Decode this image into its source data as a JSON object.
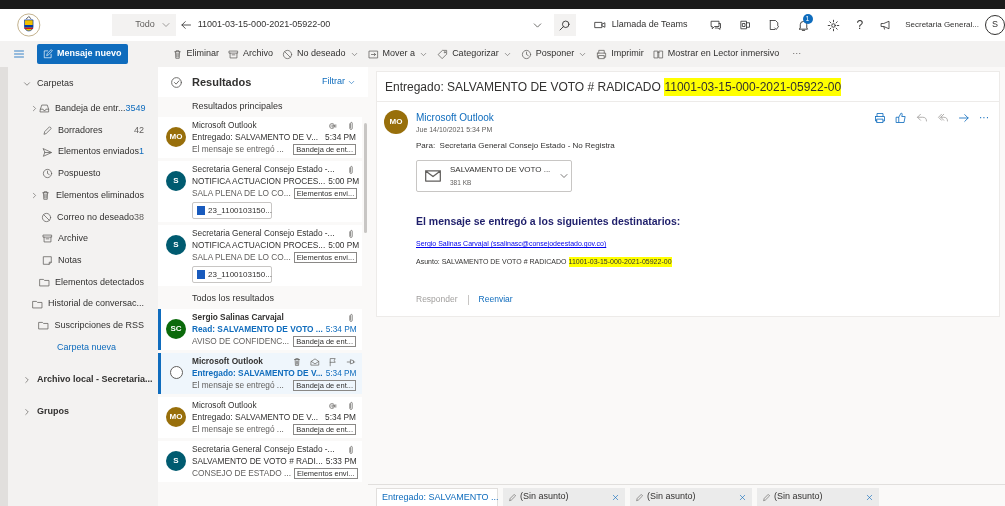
{
  "header": {
    "search_scope": "Todo",
    "search_value": "11001-03-15-000-2021-05922-00",
    "teams": "Llamada de Teams",
    "notification_badge": "1",
    "help": "?",
    "account": "Secretaria General...",
    "avatar": "S"
  },
  "toolbar": {
    "new_message": "Mensaje nuevo",
    "actions": [
      {
        "label": "Eliminar",
        "dropdown": false
      },
      {
        "label": "Archivo",
        "dropdown": false
      },
      {
        "label": "No deseado",
        "dropdown": true
      },
      {
        "label": "Mover a",
        "dropdown": true
      },
      {
        "label": "Categorizar",
        "dropdown": true
      },
      {
        "label": "Posponer",
        "dropdown": true
      },
      {
        "label": "Imprimir",
        "dropdown": false
      },
      {
        "label": "Mostrar en Lector inmersivo",
        "dropdown": false
      }
    ],
    "more": "···"
  },
  "sidebar": {
    "sections": [
      {
        "title": "Carpetas",
        "expanded": true,
        "folders": [
          {
            "name": "Bandeja de entr...",
            "count": "3549",
            "unread": true,
            "expandable": true
          },
          {
            "name": "Borradores",
            "count": "42",
            "unread": false,
            "expandable": false
          },
          {
            "name": "Elementos enviados",
            "count": "1",
            "unread": true,
            "expandable": false
          },
          {
            "name": "Pospuesto",
            "expandable": false
          },
          {
            "name": "Elementos eliminados",
            "expandable": true
          },
          {
            "name": "Correo no deseado",
            "count": "38",
            "unread": false,
            "expandable": false
          },
          {
            "name": "Archive",
            "expandable": false
          },
          {
            "name": "Notas",
            "expandable": false
          },
          {
            "name": "Elementos detectados",
            "expandable": false
          },
          {
            "name": "Historial de conversac...",
            "expandable": false
          },
          {
            "name": "Suscripciones de RSS",
            "expandable": false
          }
        ],
        "link": "Carpeta nueva"
      },
      {
        "title": "Archivo local - Secretaria...",
        "expanded": false
      },
      {
        "title": "Grupos",
        "expanded": false
      }
    ]
  },
  "message_list": {
    "title": "Resultados",
    "filter": "Filtrar",
    "groups": [
      {
        "heading": "Resultados principales",
        "messages": [
          {
            "avatar": "MO",
            "color": "#986f0b",
            "sender": "Microsoft Outlook",
            "subject": "Entregado: SALVAMENTO DE V...",
            "time": "5:34 PM",
            "preview": "El mensaje se entregó ...",
            "folder": "Bandeja de ent...",
            "conversation": true,
            "has_attachment": true,
            "unread": false,
            "selected": false
          },
          {
            "avatar": "S",
            "color": "#005b70",
            "sender": "Secretaria General Consejo Estado -...",
            "subject": "NOTIFICA ACTUACION PROCES...",
            "time": "5:00 PM",
            "preview": "SALA PLENA DE LO CO...",
            "folder": "Elementos envi...",
            "conversation": false,
            "has_attachment": true,
            "attachment": "23_1100103150...",
            "unread": false,
            "selected": false
          },
          {
            "avatar": "S",
            "color": "#005b70",
            "sender": "Secretaria General Consejo Estado -...",
            "subject": "NOTIFICA ACTUACION PROCES...",
            "time": "5:00 PM",
            "preview": "SALA PLENA DE LO CO...",
            "folder": "Elementos envi...",
            "conversation": false,
            "has_attachment": true,
            "attachment": "23_1100103150...",
            "unread": false,
            "selected": false
          }
        ]
      },
      {
        "heading": "Todos los resultados",
        "messages": [
          {
            "avatar": "SC",
            "color": "#0b6a0b",
            "sender": "Sergio Salinas Carvajal",
            "subject": "Read: SALVAMENTO DE VOTO ...",
            "time": "5:34 PM",
            "preview": "AVISO DE CONFIDENC...",
            "folder": "Bandeja de ent...",
            "conversation": false,
            "has_attachment": true,
            "unread": true,
            "selected": false
          },
          {
            "sender": "Microsoft Outlook",
            "subject": "Entregado: SALVAMENTO DE V...",
            "time": "5:34 PM",
            "preview": "El mensaje se entregó ...",
            "folder": "Bandeja de ent...",
            "conversation": false,
            "has_attachment": false,
            "unread": true,
            "selected": true
          },
          {
            "avatar": "MO",
            "color": "#986f0b",
            "sender": "Microsoft Outlook",
            "subject": "Entregado: SALVAMENTO DE V...",
            "time": "5:34 PM",
            "preview": "El mensaje se entregó ...",
            "folder": "Bandeja de ent...",
            "conversation": true,
            "has_attachment": true,
            "unread": false,
            "selected": false
          },
          {
            "avatar": "S",
            "color": "#005b70",
            "sender": "Secretaria General Consejo Estado -...",
            "subject": "SALVAMENTO DE VOTO # RADI...",
            "time": "5:33 PM",
            "preview": "CONSEJO DE ESTADO ...",
            "folder": "Elementos envi...",
            "conversation": false,
            "has_attachment": true,
            "unread": false,
            "selected": false
          }
        ]
      }
    ]
  },
  "reading_pane": {
    "subject": [
      {
        "text": "Entregado: SALVAMENTO DE VOTO # RADICADO",
        "highlighted": false
      },
      {
        "text": "11001-03-15-000-2021-05922-00",
        "highlighted": true
      }
    ],
    "avatar": "MO",
    "sender": "Microsoft Outlook",
    "more": "···",
    "date": "Jue 14/10/2021 5:34 PM",
    "to": "Para:  Secretaria General Consejo Estado - No Registra",
    "attachment": {
      "name": "SALVAMENTO DE VOTO ...",
      "size": "381 KB"
    },
    "body_heading": "El mensaje se entregó a los siguientes destinatarios:",
    "recipient_link": "Sergio Salinas Carvajal (ssalinasc@consejodeestado.gov.co)",
    "body_subject": [
      {
        "text": "Asunto: SALVAMENTO DE VOTO # RADICADO",
        "highlighted": false
      },
      {
        "text": "11001-03-15-000-2021-05922-00",
        "highlighted": true
      }
    ],
    "actions": [
      {
        "label": "Responder",
        "disabled": true
      },
      {
        "label": "Reenviar",
        "disabled": false
      }
    ]
  },
  "bottom_tabs": [
    {
      "label": "Entregado: SALVAMENTO ...",
      "draft": false,
      "selected": true
    },
    {
      "label": "(Sin asunto)",
      "draft": true,
      "selected": false
    },
    {
      "label": "(Sin asunto)",
      "draft": true,
      "selected": false
    },
    {
      "label": "(Sin asunto)",
      "draft": true,
      "selected": false
    }
  ]
}
